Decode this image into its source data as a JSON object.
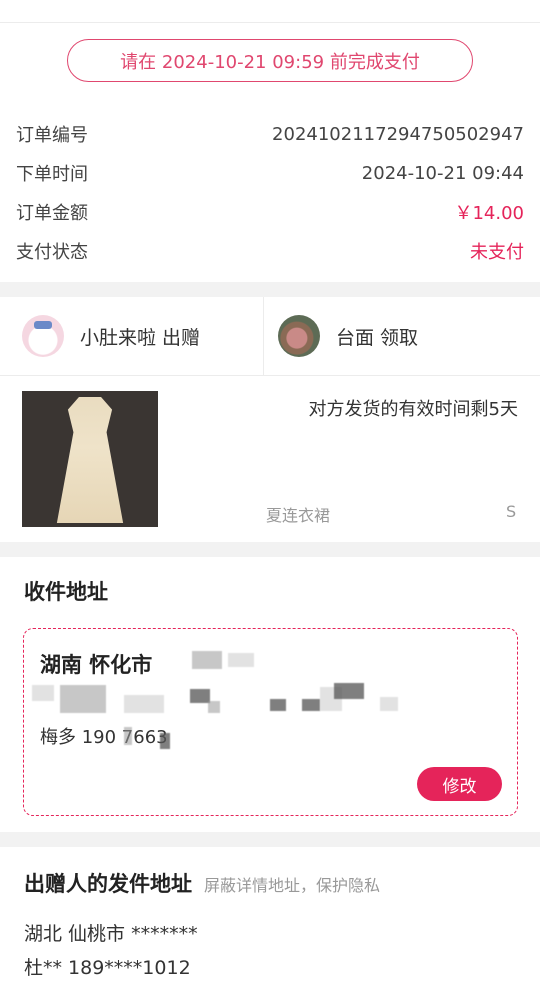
{
  "banner": {
    "deadline_text": "请在 2024-10-21 09:59 前完成支付"
  },
  "order_info": [
    {
      "label": "订单编号",
      "value": "20241021172947505029​47",
      "highlight": false
    },
    {
      "label": "下单时间",
      "value": "2024-10-21 09:44",
      "highlight": false
    },
    {
      "label": "订单金额",
      "value": "￥14.00",
      "highlight": true
    },
    {
      "label": "支付状态",
      "value": "未支付",
      "highlight": true
    }
  ],
  "parties": {
    "giver": {
      "name": "小肚来啦 出赠",
      "avatar_icon": "hello-kitty-avatar-icon"
    },
    "receiver": {
      "name": "台面 领取",
      "avatar_icon": "pig-doll-avatar-icon"
    }
  },
  "product": {
    "ship_note": "对方发货的有效时间剩5天",
    "name": "夏连衣裙",
    "size": "S"
  },
  "receiving_address": {
    "title": "收件地址",
    "region": "湖南 怀化市",
    "contact": "梅多 190    7663",
    "edit_label": "修改"
  },
  "sender_address": {
    "title": "出赠人的发件地址",
    "subtitle": "屏蔽详情地址，保护隐私",
    "region": "湖北 仙桃市 *******",
    "contact": "杜** 189****1012"
  },
  "colors": {
    "accent": "#e5245a",
    "banner": "#e0476f",
    "gap": "#f2f2f2"
  }
}
